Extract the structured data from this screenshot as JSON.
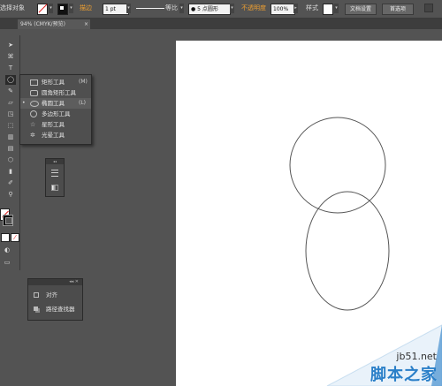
{
  "control_bar": {
    "selection_label": "选择对象",
    "stroke_label": "描边",
    "stroke_weight": "1 pt",
    "profile_label": "等比",
    "brush_label": "5 点圆形",
    "opacity_label": "不透明度",
    "opacity_value": "100%",
    "style_label": "样式",
    "doc_settings_button": "文档设置",
    "preferences_button": "首选项"
  },
  "document_tab": {
    "title": "94% (CMYK/预览)",
    "close": "×"
  },
  "tool_flyout": {
    "items": [
      {
        "label": "矩形工具",
        "shortcut": "(M)",
        "icon": "rectangle-icon"
      },
      {
        "label": "圆角矩形工具",
        "shortcut": "",
        "icon": "rounded-rectangle-icon"
      },
      {
        "label": "椭圆工具",
        "shortcut": "(L)",
        "icon": "ellipse-icon",
        "checked": true
      },
      {
        "label": "多边形工具",
        "shortcut": "",
        "icon": "polygon-icon"
      },
      {
        "label": "星形工具",
        "shortcut": "",
        "icon": "star-icon"
      },
      {
        "label": "光晕工具",
        "shortcut": "",
        "icon": "flare-icon"
      }
    ]
  },
  "align_panel": {
    "items": [
      {
        "label": "对齐",
        "icon": "align-icon"
      },
      {
        "label": "路径查找器",
        "icon": "pathfinder-icon"
      }
    ]
  },
  "watermark": {
    "site": "jb51.net",
    "name": "脚本之家"
  },
  "colors": {
    "ui_bg": "#535353",
    "artboard": "#ffffff",
    "shape_stroke": "#555555",
    "accent_orange": "#f0a030",
    "watermark_blue": "#2a7fc8"
  }
}
